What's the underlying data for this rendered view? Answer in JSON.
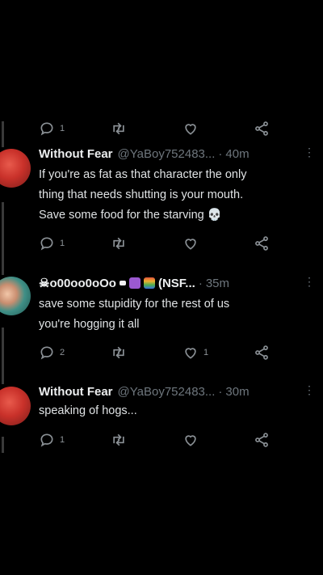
{
  "actions": {
    "top": {
      "reply_count": "1"
    },
    "tweets": [
      {
        "name": "Without Fear",
        "handle": "@YaBoy752483...",
        "separator": "·",
        "time": "40m",
        "more": "⋮",
        "lines": [
          "If you're as fat as that character the only",
          "thing that needs shutting is your mouth.",
          "Save some food for the starving 💀"
        ],
        "reply_count": "1",
        "like_count": ""
      },
      {
        "name": "☠o00oo0oOo",
        "name_suffix": "(NSF...",
        "handle": "",
        "separator": "·",
        "time": "35m",
        "more": "⋮",
        "lines": [
          "save some stupidity for the rest of us",
          "you're hogging it all"
        ],
        "reply_count": "2",
        "like_count": "1"
      },
      {
        "name": "Without Fear",
        "handle": "@YaBoy752483...",
        "separator": "·",
        "time": "30m",
        "more": "⋮",
        "lines": [
          "speaking of hogs..."
        ],
        "reply_count": "1",
        "like_count": ""
      }
    ]
  },
  "colors": {
    "background": "#000000",
    "text": "#e7e9ea",
    "muted": "#6e767d",
    "emoji_purple": "#9b59d0",
    "emoji_rainbow": "#e0533a"
  }
}
